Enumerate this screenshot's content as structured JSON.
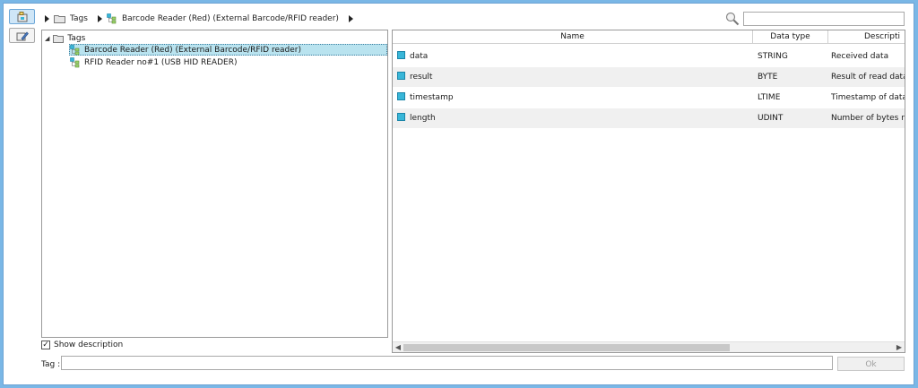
{
  "breadcrumb": {
    "items": [
      "Tags",
      "Barcode Reader (Red) (External Barcode/RFID reader)"
    ]
  },
  "search": {
    "value": "",
    "placeholder": ""
  },
  "tree": {
    "root": "Tags",
    "children": [
      "Barcode Reader (Red) (External Barcode/RFID reader)",
      "RFID Reader no#1 (USB HID READER)"
    ]
  },
  "table": {
    "columns": [
      "Name",
      "Data type",
      "Descripti"
    ],
    "rows": [
      {
        "name": "data",
        "type": "STRING",
        "desc": "Received data"
      },
      {
        "name": "result",
        "type": "BYTE",
        "desc": "Result of read data"
      },
      {
        "name": "timestamp",
        "type": "LTIME",
        "desc": "Timestamp of data re"
      },
      {
        "name": "length",
        "type": "UDINT",
        "desc": "Number of bytes rea"
      }
    ]
  },
  "footer": {
    "show_description": "Show description",
    "show_description_checked": true,
    "tag_label": "Tag :",
    "tag_value": "",
    "ok_label": "Ok"
  },
  "colors": {
    "tag_icon": "#38b6d8",
    "selected": "#b9e3ef",
    "frame": "#7ab7e6"
  }
}
